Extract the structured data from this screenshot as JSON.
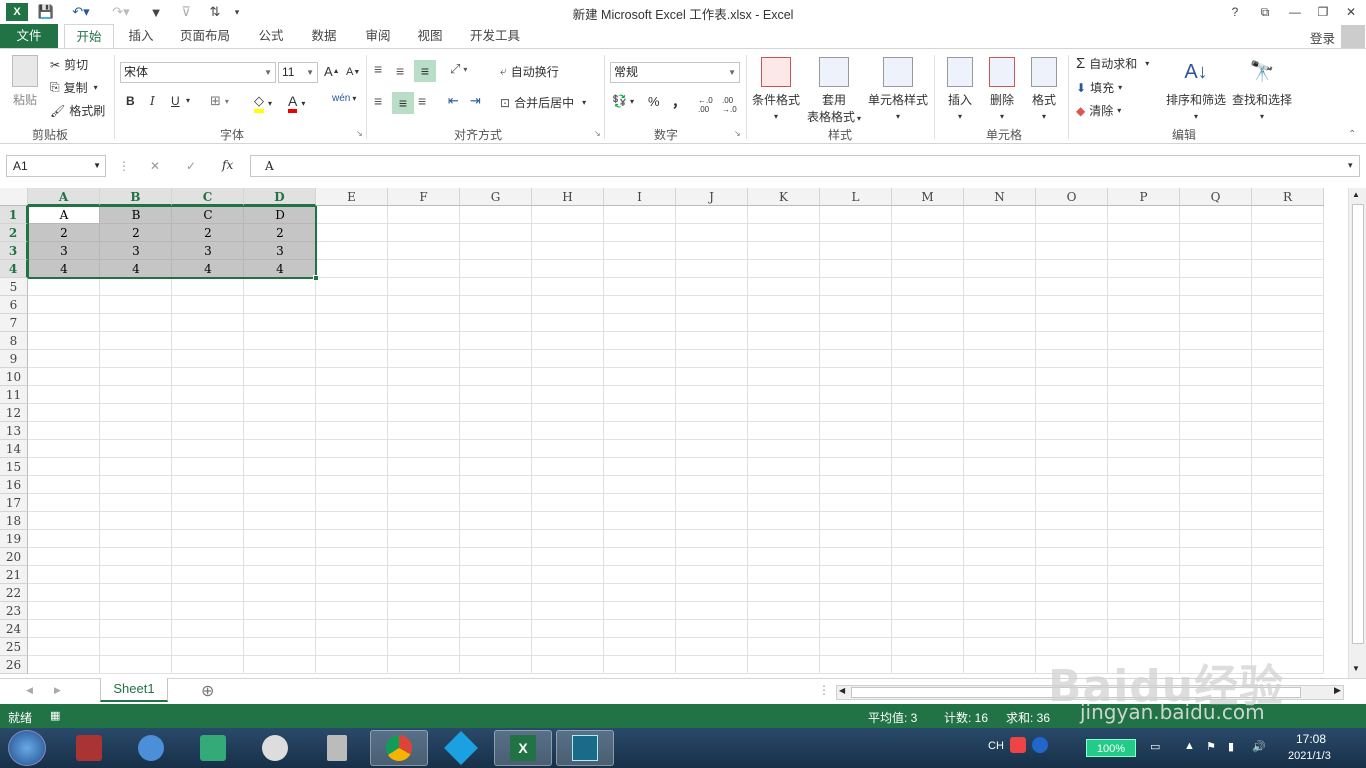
{
  "title": "新建 Microsoft Excel 工作表.xlsx - Excel",
  "window_buttons": {
    "help": "?",
    "restore_ribbon": "⧉",
    "minimize": "—",
    "maximize": "❐",
    "close": "✕"
  },
  "tabs": [
    "文件",
    "开始",
    "插入",
    "页面布局",
    "公式",
    "数据",
    "审阅",
    "视图",
    "开发工具"
  ],
  "login": "登录",
  "ribbon": {
    "clipboard": {
      "paste": "粘贴",
      "cut": "剪切",
      "copy": "复制",
      "format_painter": "格式刷",
      "label": "剪贴板"
    },
    "font": {
      "font_name": "宋体",
      "font_size": "11",
      "label": "字体",
      "bold": "B",
      "italic": "I",
      "underline": "U",
      "phonetic": "wén"
    },
    "alignment": {
      "wrap_text": "自动换行",
      "merge_center": "合并后居中",
      "label": "对齐方式"
    },
    "number": {
      "format": "常规",
      "label": "数字",
      "percent": "%",
      "comma": "，",
      "inc_decimal": "+.0 .00",
      "dec_decimal": ".00 →.0"
    },
    "styles": {
      "conditional": "条件格式",
      "table_format_1": "套用",
      "table_format_2": "表格格式",
      "cell_styles": "单元格样式",
      "label": "样式"
    },
    "cells": {
      "insert": "插入",
      "delete": "删除",
      "format": "格式",
      "label": "单元格"
    },
    "editing": {
      "autosum": "自动求和",
      "fill": "填充",
      "clear": "清除",
      "sort_filter": "排序和筛选",
      "find_select": "查找和选择",
      "label": "编辑"
    }
  },
  "formula_bar": {
    "name_box": "A1",
    "cancel": "✕",
    "enter": "✓",
    "fx": "fx",
    "value": "A"
  },
  "columns": [
    "A",
    "B",
    "C",
    "D",
    "E",
    "F",
    "G",
    "H",
    "I",
    "J",
    "K",
    "L",
    "M",
    "N",
    "O",
    "P",
    "Q",
    "R"
  ],
  "rows": [
    "1",
    "2",
    "3",
    "4",
    "5",
    "6",
    "7",
    "8",
    "9",
    "10",
    "11",
    "12",
    "13",
    "14",
    "15",
    "16",
    "17",
    "18",
    "19",
    "20",
    "21",
    "22",
    "23",
    "24",
    "25",
    "26"
  ],
  "cells": [
    [
      "A",
      "B",
      "C",
      "D"
    ],
    [
      "2",
      "2",
      "2",
      "2"
    ],
    [
      "3",
      "3",
      "3",
      "3"
    ],
    [
      "4",
      "4",
      "4",
      "4"
    ]
  ],
  "sheet_tabs": [
    "Sheet1"
  ],
  "add_sheet": "⊕",
  "status": {
    "ready": "就绪",
    "average": "平均值: 3",
    "count": "计数: 16",
    "sum": "求和: 36"
  },
  "taskbar": {
    "lang": "CH",
    "battery": "100%",
    "time": "17:08",
    "date": "2021/1/3"
  },
  "watermark": "Baidu经验",
  "watermark_sub": "jingyan.baidu.com",
  "colors": {
    "excel_green": "#217346",
    "selection_fill": "#c6c6c6"
  }
}
